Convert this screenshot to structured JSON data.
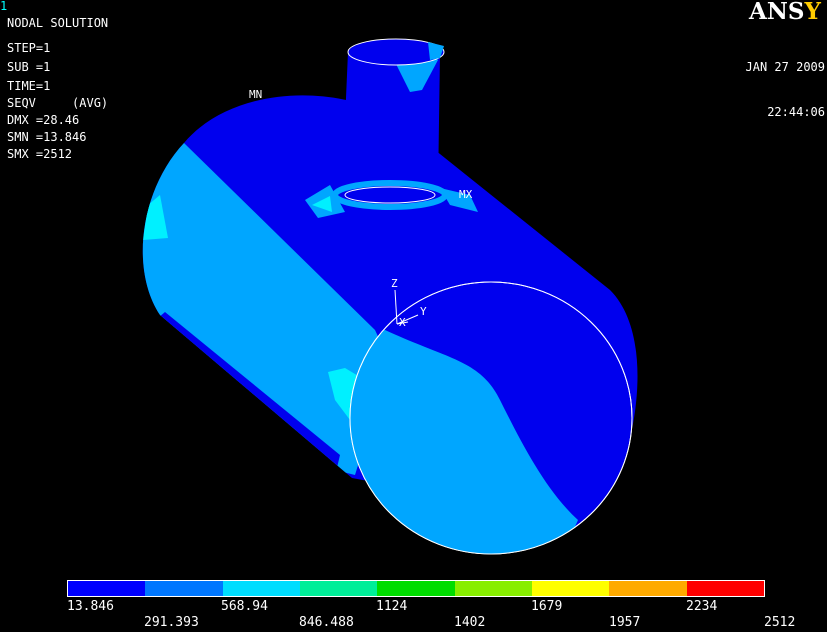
{
  "window_number": "1",
  "header": {
    "title": "NODAL SOLUTION",
    "lines": [
      "STEP=1",
      "SUB =1",
      "TIME=1",
      "SEQV     (AVG)",
      "DMX =28.46",
      "SMN =13.846",
      "SMX =2512"
    ]
  },
  "logo": {
    "part1": "ANS",
    "part2": "Y"
  },
  "date": {
    "date": "JAN 27 2009",
    "time": "22:44:06"
  },
  "markers": {
    "min_label": "MN",
    "max_label": "MX"
  },
  "axes": {
    "z": "Z",
    "y": "Y",
    "x": "X"
  },
  "legend": {
    "colors": [
      "#0000ff",
      "#0077ff",
      "#00ddff",
      "#00ee99",
      "#00dd00",
      "#88ee00",
      "#ffff00",
      "#ffaa00",
      "#ff0000"
    ],
    "top_labels": [
      "13.846",
      "568.94",
      "1124",
      "1679",
      "2234"
    ],
    "bottom_labels": [
      "291.393",
      "846.488",
      "1402",
      "1957",
      "2512"
    ]
  },
  "colors": {
    "dark_blue": "#0000ee",
    "mid_blue": "#00a6ff",
    "cyan": "#00ffff",
    "background": "#000000"
  }
}
